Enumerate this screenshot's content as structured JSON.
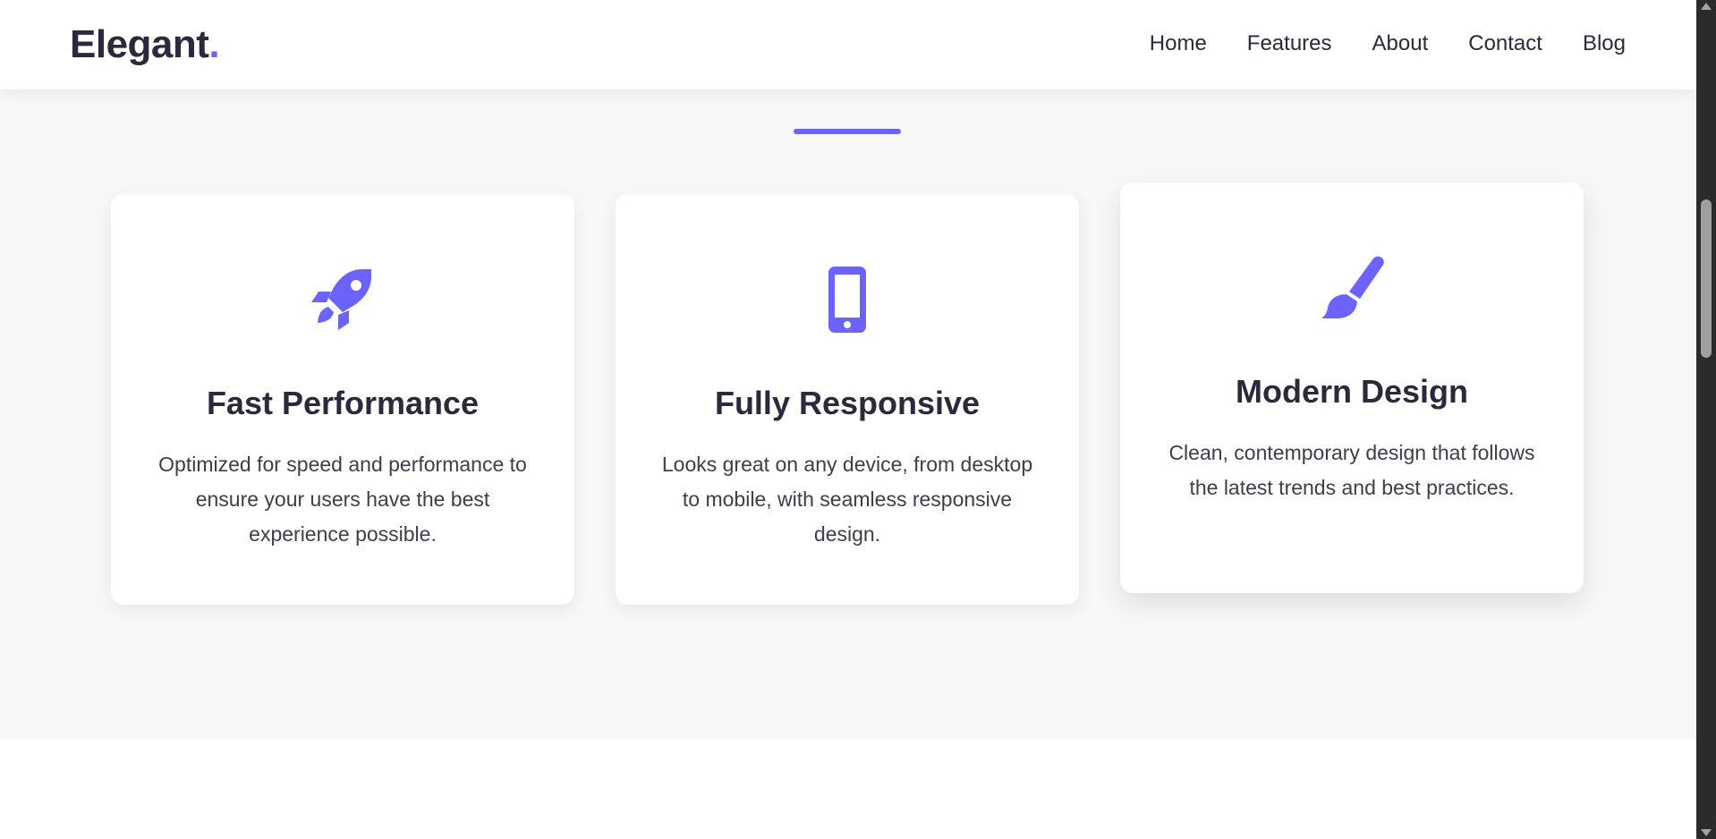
{
  "navbar": {
    "logo_text": "Elegant",
    "logo_dot": ".",
    "links": [
      "Home",
      "Features",
      "About",
      "Contact",
      "Blog"
    ]
  },
  "features": {
    "cards": [
      {
        "icon": "rocket-icon",
        "title": "Fast Performance",
        "text": "Optimized for speed and performance to ensure your users have the best experience possible."
      },
      {
        "icon": "mobile-phone-icon",
        "title": "Fully Responsive",
        "text": "Looks great on any device, from desktop to mobile, with seamless responsive design."
      },
      {
        "icon": "paintbrush-icon",
        "title": "Modern Design",
        "text": "Clean, contemporary design that follows the latest trends and best practices."
      }
    ]
  },
  "colors": {
    "accent": "#6c63ff",
    "heading": "#2b2a3d",
    "section_bg": "#f8f8f8",
    "card_bg": "#ffffff"
  }
}
